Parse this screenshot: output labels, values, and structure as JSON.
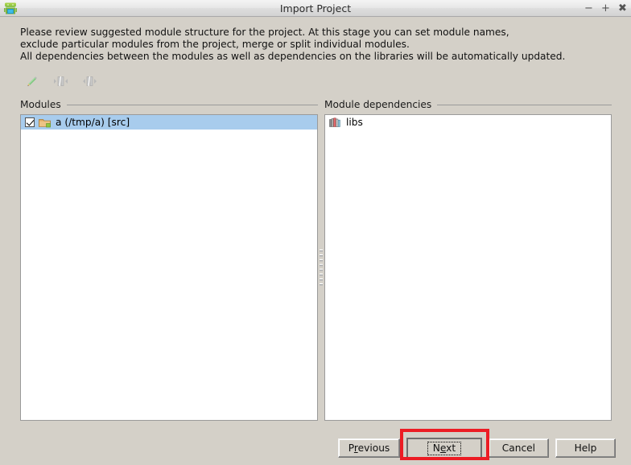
{
  "window": {
    "title": "Import Project",
    "icon": "android-robot-icon",
    "controls": [
      {
        "name": "minimize-button",
        "glyph": "−"
      },
      {
        "name": "maximize-button",
        "glyph": "+"
      },
      {
        "name": "close-button",
        "glyph": "✖"
      }
    ]
  },
  "intro": {
    "text": "Please review suggested module structure for the project. At this stage you can set module names,\nexclude particular modules from the project, merge or split individual modules.\nAll dependencies between the modules as well as dependencies on the libraries will be automatically updated."
  },
  "toolbar": {
    "buttons": [
      {
        "name": "edit-pencil-icon",
        "label": "Edit",
        "enabled": true
      },
      {
        "name": "merge-modules-icon",
        "label": "Merge",
        "enabled": false
      },
      {
        "name": "split-module-icon",
        "label": "Split",
        "enabled": false
      }
    ]
  },
  "modules_panel": {
    "title": "Modules",
    "items": [
      {
        "label": "a (/tmp/a) [src]",
        "checked": true,
        "selected": true,
        "icon": "module-folder-icon"
      }
    ]
  },
  "dependencies_panel": {
    "title": "Module dependencies",
    "items": [
      {
        "label": "libs",
        "icon": "library-books-icon"
      }
    ]
  },
  "buttons": {
    "previous": {
      "pre": "P",
      "mnemonic": "r",
      "post": "evious"
    },
    "next": {
      "pre": "N",
      "mnemonic": "e",
      "post": "xt"
    },
    "cancel": {
      "label": "Cancel"
    },
    "help": {
      "label": "Help"
    }
  },
  "highlight": {
    "target": "next-button",
    "color": "#ec1c24"
  },
  "colors": {
    "dialog_background": "#d4d0c8",
    "selection": "#a8cced",
    "panel_background": "#ffffff",
    "highlight": "#ec1c24"
  }
}
